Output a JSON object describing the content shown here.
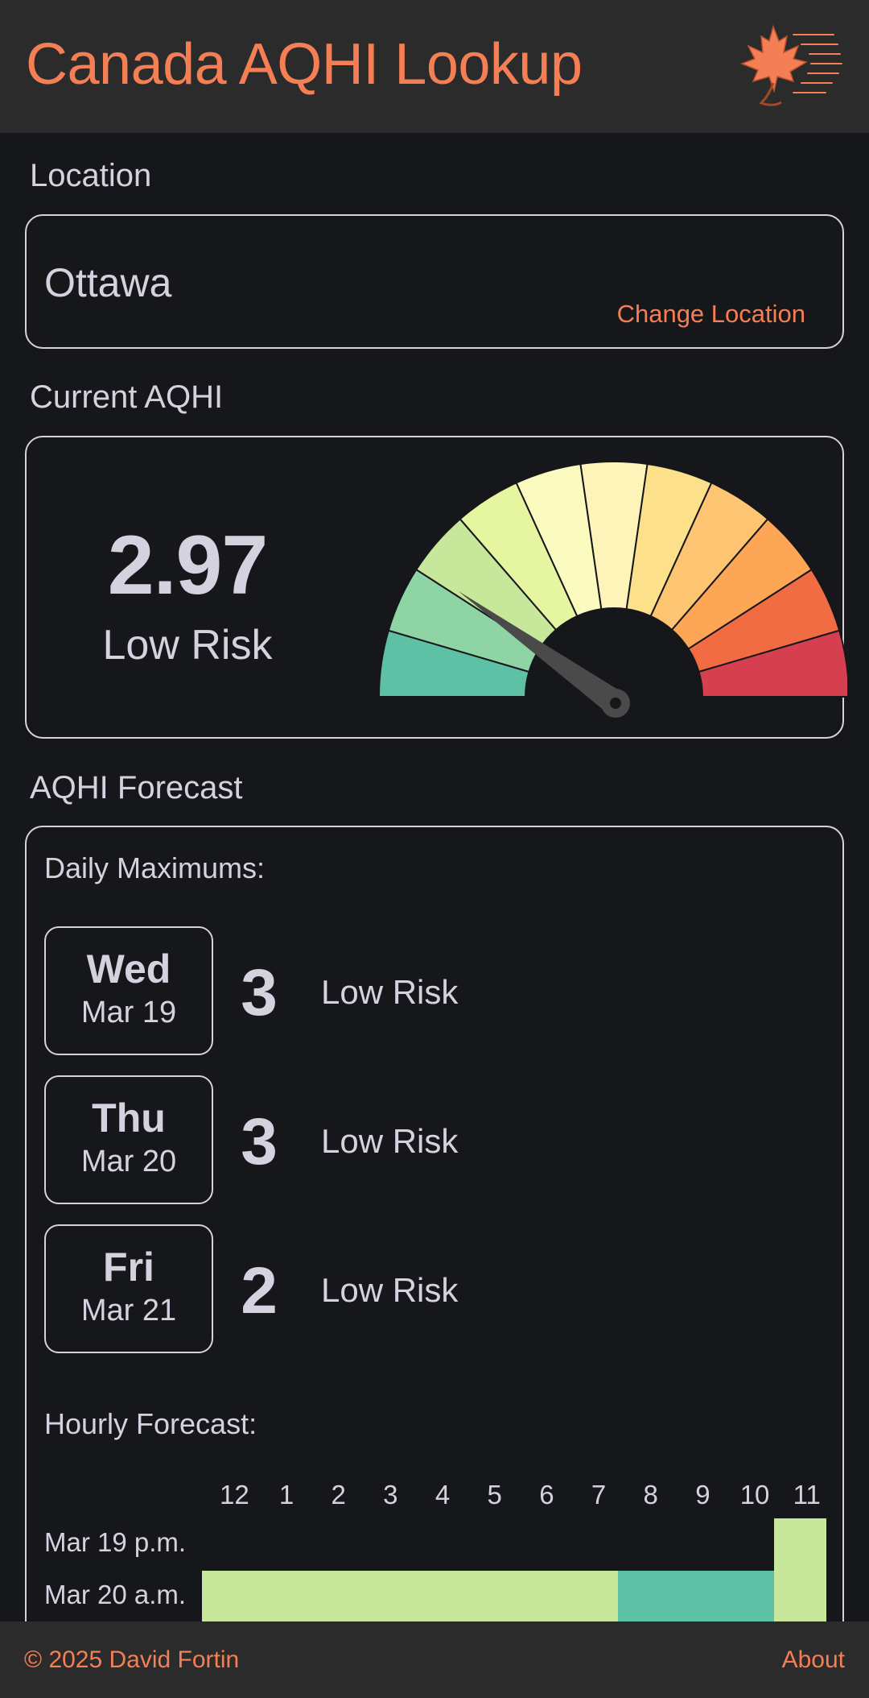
{
  "header": {
    "title": "Canada AQHI Lookup",
    "logo_icon": "maple-leaf-wind-icon",
    "accent": "#f47f55"
  },
  "location": {
    "section_label": "Location",
    "name": "Ottawa",
    "change_label": "Change Location"
  },
  "current": {
    "section_label": "Current AQHI",
    "value": "2.97",
    "risk": "Low Risk",
    "gauge": {
      "min": 1,
      "max": 11,
      "value": 2.97,
      "segment_colors": [
        "#5ec1a6",
        "#8fd4a5",
        "#c7e79a",
        "#e6f5a0",
        "#fbfbbf",
        "#fef3b8",
        "#fde08a",
        "#fdc471",
        "#fda656",
        "#f26c43",
        "#d63f4f"
      ]
    }
  },
  "forecast": {
    "section_label": "AQHI Forecast",
    "daily_label": "Daily Maximums:",
    "days": [
      {
        "day": "Wed",
        "date": "Mar 19",
        "value": "3",
        "risk": "Low Risk"
      },
      {
        "day": "Thu",
        "date": "Mar 20",
        "value": "3",
        "risk": "Low Risk"
      },
      {
        "day": "Fri",
        "date": "Mar 21",
        "value": "2",
        "risk": "Low Risk"
      }
    ],
    "hourly_label": "Hourly Forecast:",
    "hours": [
      "12",
      "1",
      "2",
      "3",
      "4",
      "5",
      "6",
      "7",
      "8",
      "9",
      "10",
      "11"
    ],
    "rows": [
      {
        "label": "Mar 19 p.m.",
        "colors": [
          null,
          null,
          null,
          null,
          null,
          null,
          null,
          null,
          null,
          null,
          null,
          "#c7e79a"
        ]
      },
      {
        "label": "Mar 20 a.m.",
        "colors": [
          "#c7e79a",
          "#c7e79a",
          "#c7e79a",
          "#c7e79a",
          "#c7e79a",
          "#c7e79a",
          "#c7e79a",
          "#c7e79a",
          "#5ec1a6",
          "#5ec1a6",
          "#5ec1a6",
          "#c7e79a"
        ]
      }
    ]
  },
  "footer": {
    "copyright": "© 2025 David Fortin",
    "about": "About"
  }
}
